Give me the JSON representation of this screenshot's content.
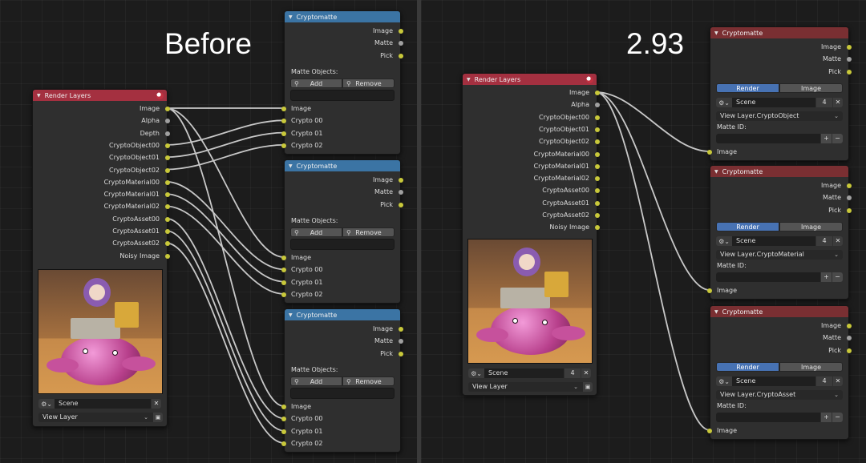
{
  "headings": {
    "before": "Before",
    "after": "2.93"
  },
  "colors": {
    "socket_color": "#c8c83a",
    "socket_value": "#a0a0a0",
    "header_render_layers": "#a43040",
    "header_cryptomatte_old": "#3b74a4",
    "header_cryptomatte_new": "#7a2f32",
    "accent_toggle": "#4772b3",
    "wire": "#c8c8c8"
  },
  "left": {
    "render_layers": {
      "title": "Render Layers",
      "outputs": [
        "Image",
        "Alpha",
        "Depth",
        "CryptoObject00",
        "CryptoObject01",
        "CryptoObject02",
        "CryptoMaterial00",
        "CryptoMaterial01",
        "CryptoMaterial02",
        "CryptoAsset00",
        "CryptoAsset01",
        "CryptoAsset02",
        "Noisy Image"
      ],
      "scene": "Scene",
      "clear_icon": "close-icon",
      "view_layer": "View Layer"
    },
    "cryptomatte_nodes": [
      {
        "title": "Cryptomatte",
        "outputs": [
          "Image",
          "Matte",
          "Pick"
        ],
        "matte_objects_label": "Matte Objects:",
        "add_label": "Add",
        "remove_label": "Remove",
        "inputs": [
          "Image",
          "Crypto 00",
          "Crypto 01",
          "Crypto 02"
        ]
      },
      {
        "title": "Cryptomatte",
        "outputs": [
          "Image",
          "Matte",
          "Pick"
        ],
        "matte_objects_label": "Matte Objects:",
        "add_label": "Add",
        "remove_label": "Remove",
        "inputs": [
          "Image",
          "Crypto 00",
          "Crypto 01",
          "Crypto 02"
        ]
      },
      {
        "title": "Cryptomatte",
        "outputs": [
          "Image",
          "Matte",
          "Pick"
        ],
        "matte_objects_label": "Matte Objects:",
        "add_label": "Add",
        "remove_label": "Remove",
        "inputs": [
          "Image",
          "Crypto 00",
          "Crypto 01",
          "Crypto 02"
        ]
      }
    ]
  },
  "right": {
    "render_layers": {
      "title": "Render Layers",
      "outputs": [
        "Image",
        "Alpha",
        "CryptoObject00",
        "CryptoObject01",
        "CryptoObject02",
        "CryptoMaterial00",
        "CryptoMaterial01",
        "CryptoMaterial02",
        "CryptoAsset00",
        "CryptoAsset01",
        "CryptoAsset02",
        "Noisy Image"
      ],
      "scene": "Scene",
      "scene_users": "4",
      "view_layer": "View Layer"
    },
    "cryptomatte_nodes": [
      {
        "title": "Cryptomatte",
        "outputs": [
          "Image",
          "Matte",
          "Pick"
        ],
        "source_render": "Render",
        "source_image": "Image",
        "active_source": "Render",
        "scene": "Scene",
        "scene_users": "4",
        "layer": "View Layer.CryptoObject",
        "matte_id_label": "Matte ID:",
        "plus": "+",
        "minus": "−",
        "input": "Image"
      },
      {
        "title": "Cryptomatte",
        "outputs": [
          "Image",
          "Matte",
          "Pick"
        ],
        "source_render": "Render",
        "source_image": "Image",
        "active_source": "Render",
        "scene": "Scene",
        "scene_users": "4",
        "layer": "View Layer.CryptoMaterial",
        "matte_id_label": "Matte ID:",
        "plus": "+",
        "minus": "−",
        "input": "Image"
      },
      {
        "title": "Cryptomatte",
        "outputs": [
          "Image",
          "Matte",
          "Pick"
        ],
        "source_render": "Render",
        "source_image": "Image",
        "active_source": "Render",
        "scene": "Scene",
        "scene_users": "4",
        "layer": "View Layer.CryptoAsset",
        "matte_id_label": "Matte ID:",
        "plus": "+",
        "minus": "−",
        "input": "Image"
      }
    ]
  }
}
